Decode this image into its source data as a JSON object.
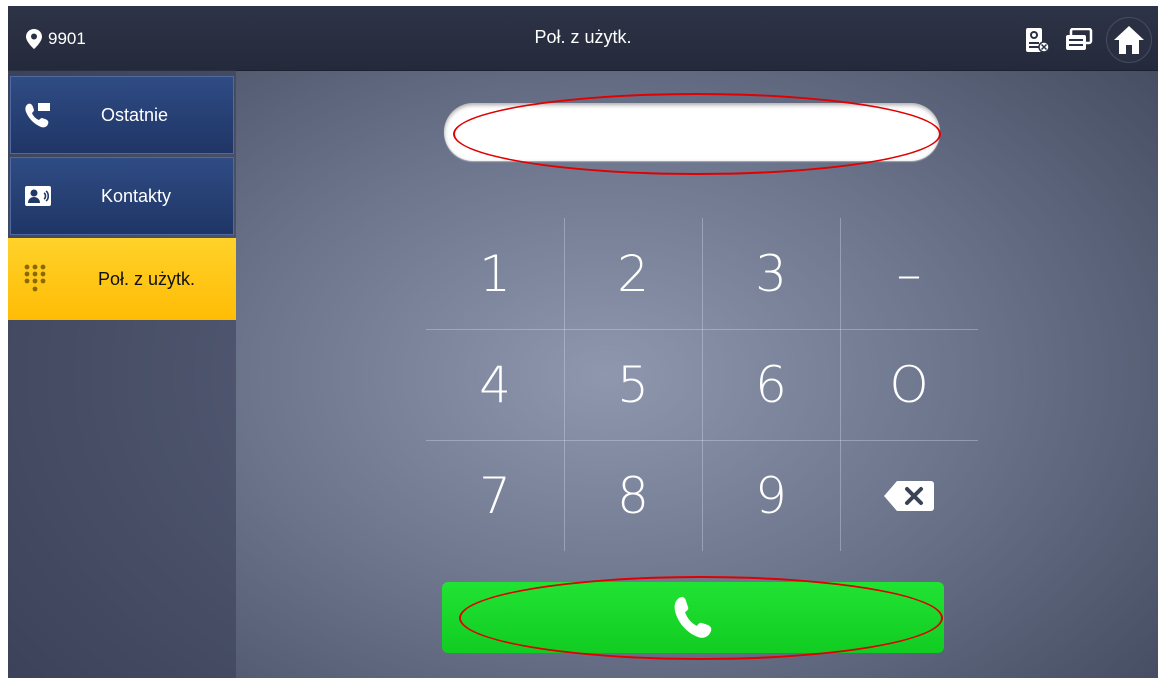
{
  "header": {
    "room_number": "9901",
    "title": "Poł. z użytk.",
    "icons": [
      "location-pin-icon",
      "monitor-camera-icon",
      "cards-icon",
      "home-icon"
    ]
  },
  "sidebar": {
    "items": [
      {
        "label": "Ostatnie",
        "icon": "recent-calls-icon",
        "active": false
      },
      {
        "label": "Kontakty",
        "icon": "contacts-icon",
        "active": false
      },
      {
        "label": "Poł. z użytk.",
        "icon": "dialpad-icon",
        "active": true
      }
    ]
  },
  "number_field": {
    "value": ""
  },
  "keypad": {
    "keys": [
      "1",
      "2",
      "3",
      "–",
      "4",
      "5",
      "6",
      "O",
      "7",
      "8",
      "9",
      "backspace"
    ]
  },
  "call_button": {
    "icon": "phone-icon"
  },
  "colors": {
    "topbar": "#2e3447",
    "sidebar_item": "#2f4c84",
    "active_item": "#ffc20e",
    "call_button": "#11cc21",
    "annotation": "#e00000"
  }
}
